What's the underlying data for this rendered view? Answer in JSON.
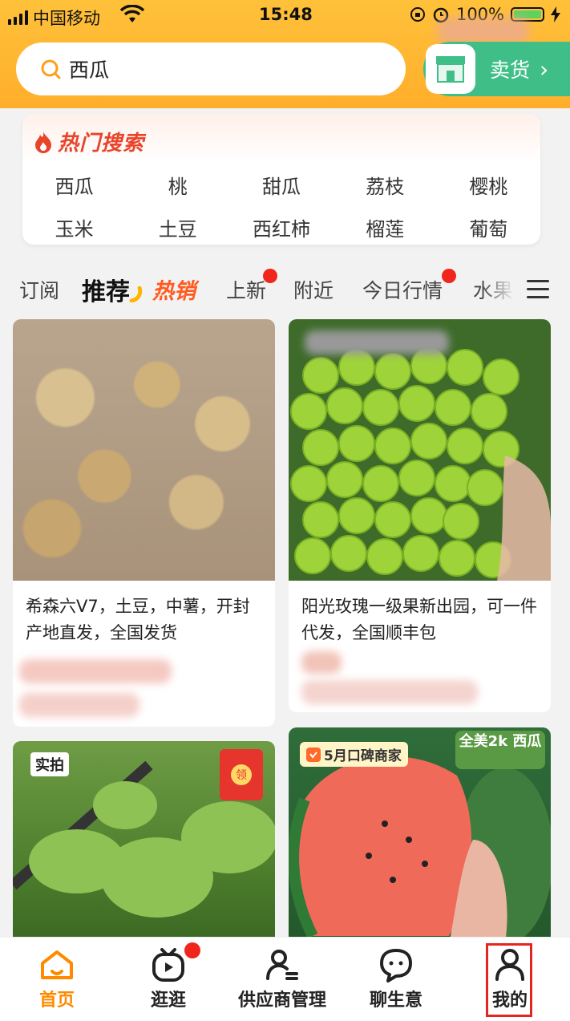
{
  "status_bar": {
    "carrier": "中国移动",
    "time": "15:48",
    "battery": "100%"
  },
  "search": {
    "value": "西瓜"
  },
  "sell_button": {
    "label": "卖货"
  },
  "hot_search": {
    "title": "热门搜索",
    "rows": [
      [
        "西瓜",
        "桃",
        "甜瓜",
        "荔枝",
        "樱桃"
      ],
      [
        "玉米",
        "土豆",
        "西红柿",
        "榴莲",
        "葡萄"
      ]
    ]
  },
  "tabs": [
    "订阅",
    "推荐",
    "热销",
    "上新",
    "附近",
    "今日行情",
    "水果"
  ],
  "products": [
    {
      "title": "希森六V7，土豆，中薯，开封产地直发，全国发货"
    },
    {
      "title": "阳光玫瑰一级果新出园，可一件代发，全国顺丰包"
    },
    {
      "badge": "实拍",
      "coupon": "领"
    },
    {
      "badge": "5月口碑商家",
      "overlay": "全美2k 西瓜"
    }
  ],
  "bottom_nav": [
    {
      "label": "首页",
      "icon": "home-icon",
      "active": true
    },
    {
      "label": "逛逛",
      "icon": "tv-play-icon",
      "badge": true
    },
    {
      "label": "供应商管理",
      "icon": "supplier-person-icon"
    },
    {
      "label": "聊生意",
      "icon": "chat-bubble-icon"
    },
    {
      "label": "我的",
      "icon": "user-icon"
    }
  ],
  "colors": {
    "accent": "#ffae2b",
    "sell_green": "#3fbf87",
    "hot_red": "#e8442a",
    "active_tab": "#ff8a00"
  }
}
